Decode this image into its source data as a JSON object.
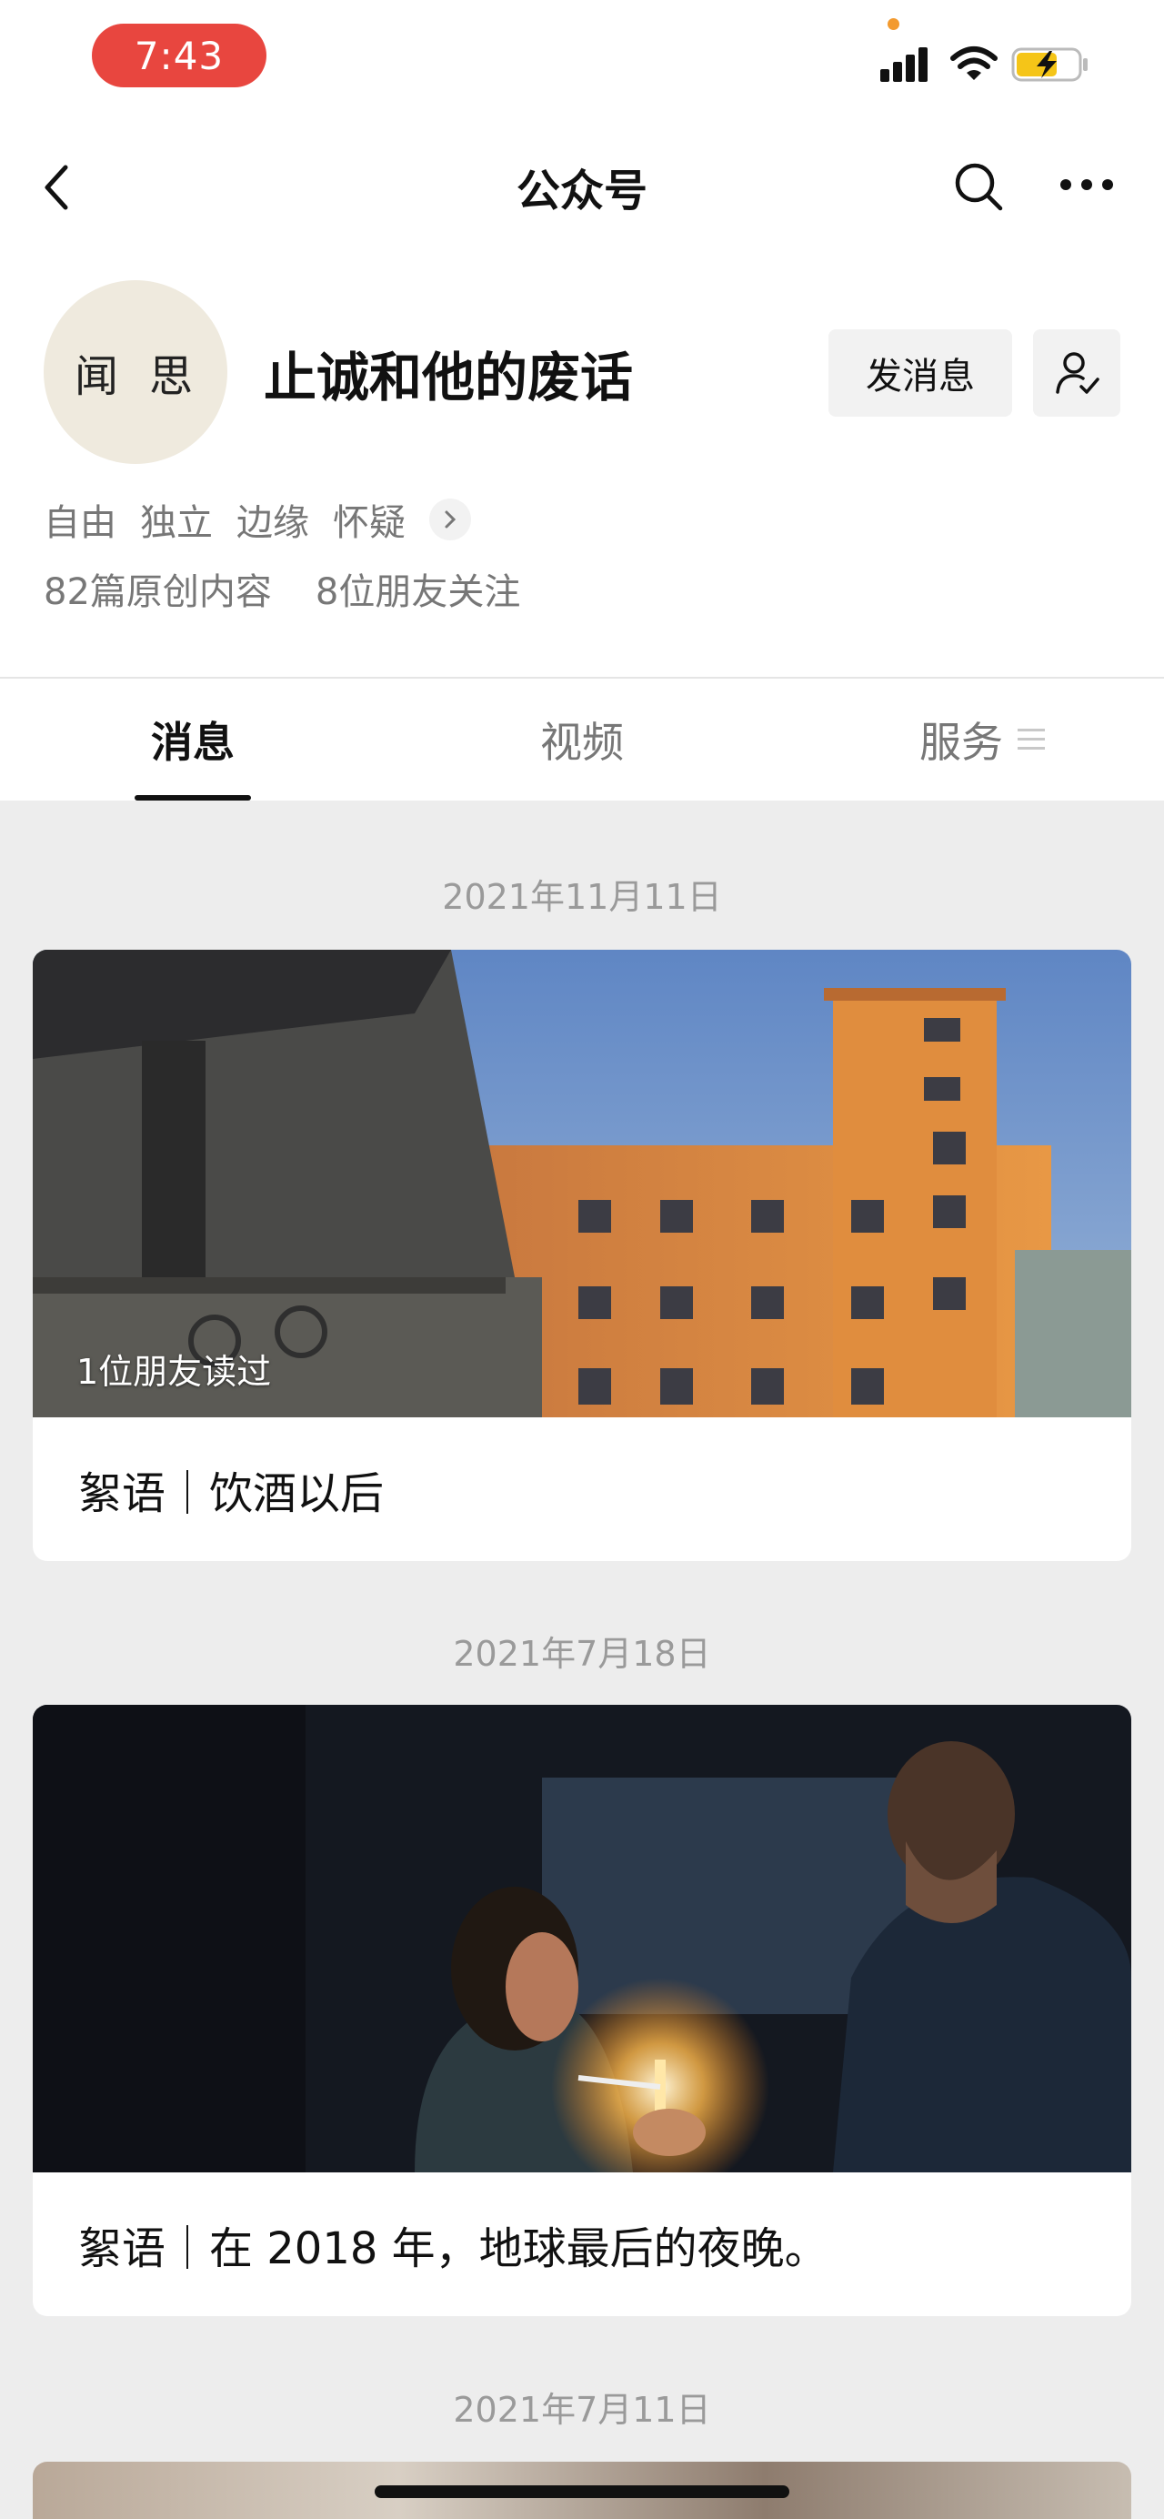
{
  "status_bar": {
    "time": "7:43",
    "time_pill_color": "#e8463f",
    "icons": [
      "cellular-signal-icon",
      "wifi-icon",
      "battery-charging-icon"
    ]
  },
  "nav": {
    "title": "公众号",
    "icons": [
      "back-icon",
      "search-icon",
      "more-icon"
    ]
  },
  "profile": {
    "avatar_text": "闻思",
    "name": "止诚和他的废话",
    "message_button": "发消息",
    "follow_icon": "followed-user-icon",
    "tags": [
      "自由",
      "独立",
      "边缘",
      "怀疑"
    ],
    "original_count": "82篇原创内容",
    "friends_follow": "8位朋友关注"
  },
  "tabs": [
    {
      "label": "消息",
      "active": true
    },
    {
      "label": "视频",
      "active": false
    },
    {
      "label": "服务",
      "active": false
    }
  ],
  "feed": [
    {
      "date": "2021年11月11日",
      "friend_read": "1位朋友读过",
      "title": "絮语｜饮酒以后"
    },
    {
      "date": "2021年7月18日",
      "friend_read": "",
      "title": "絮语｜在 2018 年，地球最后的夜晚。"
    },
    {
      "date": "2021年7月11日",
      "friend_read": "",
      "title": ""
    }
  ],
  "colors": {
    "accent_dark": "#111111",
    "muted_text": "#777777",
    "background": "#ededed"
  }
}
